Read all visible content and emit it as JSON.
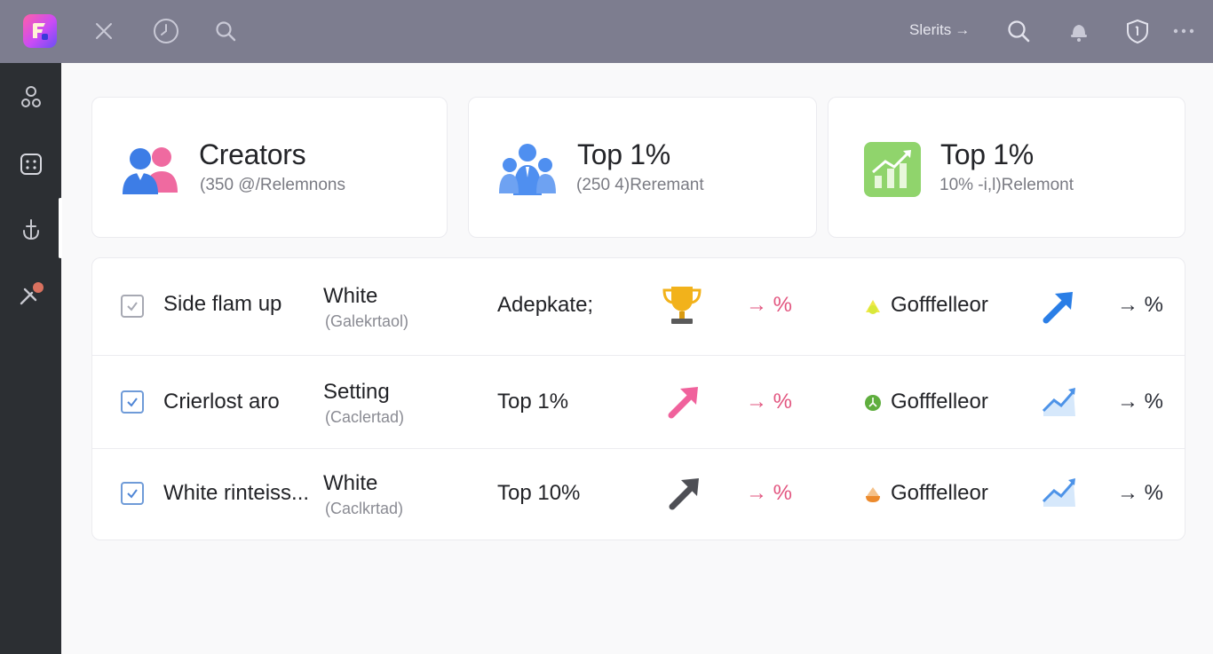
{
  "topbar": {
    "right_text": "Slerits",
    "right_text_arrow": "→"
  },
  "cards": [
    {
      "title": "Creators",
      "subtitle": "(350 @/Relemnons"
    },
    {
      "title": "Top 1%",
      "subtitle": "(250 4)Reremant"
    },
    {
      "title": "Top 1%",
      "subtitle": "10% -i,l)Relemont"
    }
  ],
  "rows": [
    {
      "name": "Side flam up",
      "type": "White",
      "type_sub": "(Galekrtaol)",
      "rank": "Adepkate;",
      "pct_pink": "→ %",
      "org": "Gofffelleor",
      "pct_blue": "→ %",
      "pink_icon": "trophy-icon",
      "blue_icon": "arrow-up-right-icon"
    },
    {
      "name": "Crierlost aro",
      "type": "Setting",
      "type_sub": "(Caclertad)",
      "rank": "Top 1%",
      "pct_pink": "→ %",
      "org": "Gofffelleor",
      "pct_blue": "→ %",
      "pink_icon": "arrow-up-right-icon",
      "blue_icon": "trend-chart-icon"
    },
    {
      "name": "White rinteiss...",
      "type": "White",
      "type_sub": "(Caclkrtad)",
      "rank": "Top 10%",
      "pct_pink": "→ %",
      "org": "Gofffelleor",
      "pct_blue": "→ %",
      "pink_icon": "arrow-up-right-icon",
      "blue_icon": "trend-chart-icon"
    }
  ],
  "colors": {
    "topbar": "#7d7d8f",
    "sidebar": "#2c2f33",
    "pink_accent": "#e2557f",
    "blue_accent": "#2e7de0",
    "green_accent": "#8fd16a"
  }
}
